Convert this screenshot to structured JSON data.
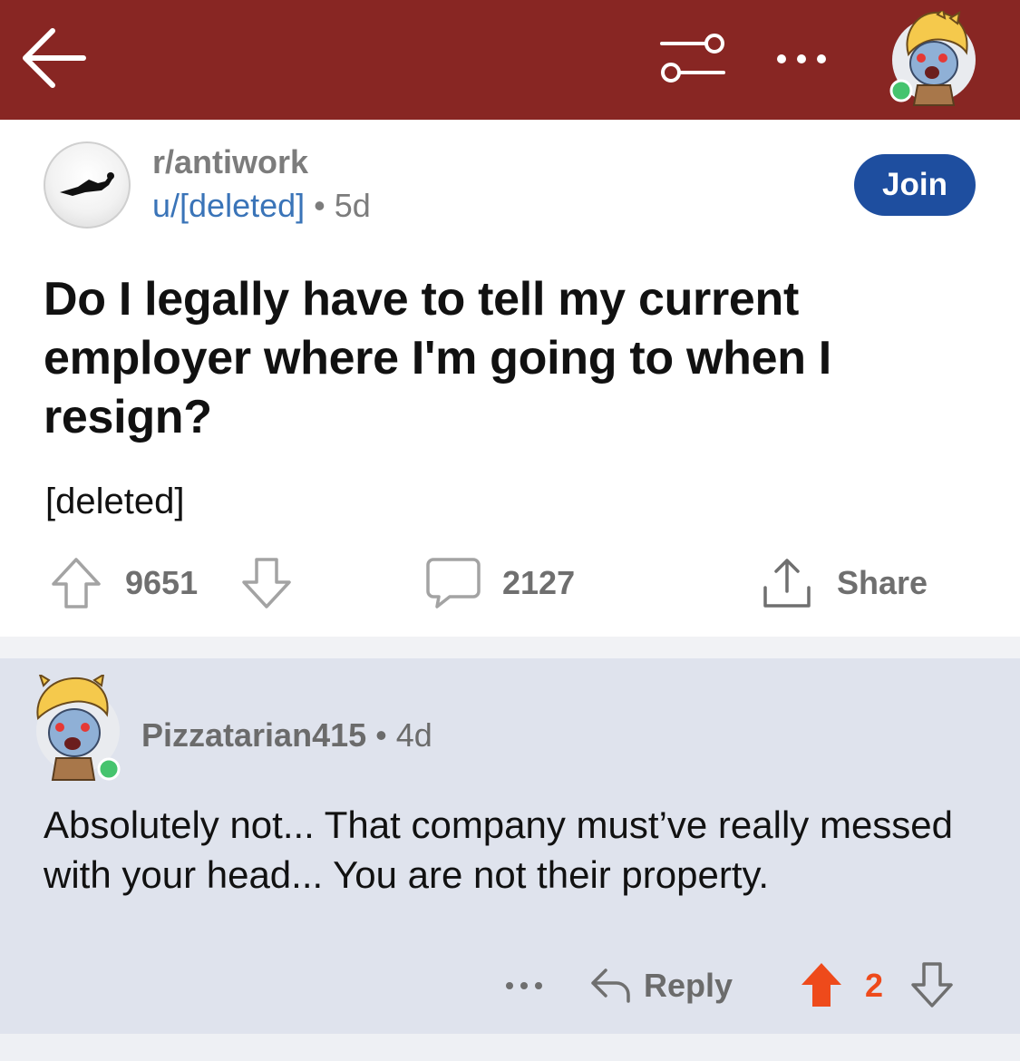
{
  "post": {
    "subreddit": "r/antiwork",
    "author": "u/[deleted]",
    "separator": "•",
    "age": "5d",
    "join_label": "Join",
    "title": "Do I legally have to tell my current employer where I'm going to when I resign?",
    "body": "[deleted]",
    "upvotes": "9651",
    "comments": "2127",
    "share_label": "Share"
  },
  "comment": {
    "author": "Pizzatarian415",
    "separator": "•",
    "age": "4d",
    "body": "Absolutely not... That company must’ve really messed with your head... You are not their property.",
    "more_label": "...",
    "reply_label": "Reply",
    "score": "2"
  },
  "colors": {
    "header": "#882623",
    "join": "#1e4e9f",
    "username": "#3a74b8",
    "upvoted": "#ee4a1b",
    "comment_bg": "#dfe3ed",
    "online": "#46c46e"
  },
  "icons": [
    "back-arrow-icon",
    "filter-icon",
    "more-icon",
    "user-avatar",
    "subreddit-icon",
    "upvote-icon",
    "downvote-icon",
    "comment-icon",
    "share-icon",
    "reply-icon"
  ]
}
